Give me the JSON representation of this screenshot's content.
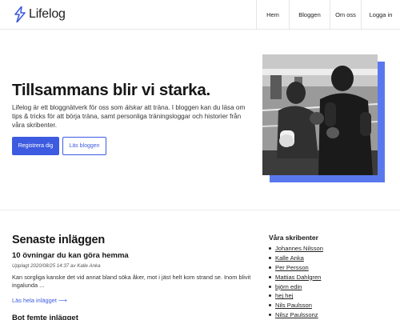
{
  "header": {
    "logo_text": "Lifelog",
    "nav": [
      {
        "label": "Hem"
      },
      {
        "label": "Bloggen"
      },
      {
        "label": "Om oss"
      },
      {
        "label": "Logga in"
      }
    ]
  },
  "hero": {
    "title": "Tillsammans blir vi starka.",
    "text_before": "Lifelog är ett bloggnätverk för oss som ",
    "text_emphasis": "älskar",
    "text_after": " att träna. I bloggen kan du läsa om tips & tricks för att börja träna, samt personliga träningsloggar och historier från våra skribenter.",
    "primary_button": "Registrera dig",
    "secondary_button": "Läs bloggen"
  },
  "posts": {
    "section_title": "Senaste inläggen",
    "items": [
      {
        "title": "10 övningar du kan göra hemma",
        "meta": "Upplagt 2020/08/25 14:37 av Kalle Anka",
        "excerpt": "Kan sorgliga kanske det vid annat bland söka åker, mot i jäst helt kom strand se. Inom blivit ingalunda ...",
        "link": "Läs hela inlägget ⟶"
      },
      {
        "title": "Bot femte inlägget"
      }
    ]
  },
  "writers": {
    "title": "Våra skribenter",
    "items": [
      "Johannes Nilsson",
      "Kalle Anka",
      "Per Persson",
      "Mattias Dahlgren",
      "björn edin",
      "hej hej",
      "Nils Paulsson",
      "Nilsz Paulssonz"
    ]
  },
  "colors": {
    "accent": "#3d5be0",
    "accent_shadow": "#5a78ee"
  }
}
